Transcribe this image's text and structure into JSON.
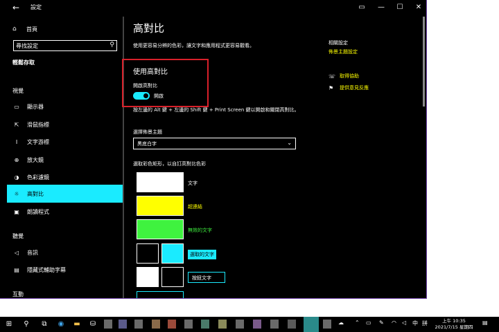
{
  "window": {
    "title": "設定",
    "back_icon": "back-arrow-icon",
    "controls": [
      "minimize-icon",
      "maximize-icon",
      "close-icon"
    ],
    "border_color": "#6b3fa8"
  },
  "sidebar": {
    "home_label": "首頁",
    "search_value": "尋找設定",
    "category": "輕鬆存取",
    "groups": [
      "視覺",
      "聽覺",
      "互動"
    ],
    "items": [
      {
        "label": "顯示器",
        "icon": "monitor-icon"
      },
      {
        "label": "滑鼠指標",
        "icon": "mouse-pointer-icon"
      },
      {
        "label": "文字游標",
        "icon": "text-cursor-icon"
      },
      {
        "label": "放大鏡",
        "icon": "magnifier-icon"
      },
      {
        "label": "色彩濾鏡",
        "icon": "color-filter-icon"
      },
      {
        "label": "高對比",
        "icon": "high-contrast-icon",
        "active": true
      },
      {
        "label": "朗讀程式",
        "icon": "narrator-icon"
      },
      {
        "label": "音訊",
        "icon": "speaker-icon"
      },
      {
        "label": "隱藏式輔助字幕",
        "icon": "captions-icon"
      }
    ]
  },
  "main": {
    "title": "高對比",
    "description": "使用更容易分辨的色彩，讓文字和應用程式更容易觀看。",
    "section_title": "使用高對比",
    "toggle_label": "開啟高對比",
    "toggle_state": "開啟",
    "toggle_on": true,
    "hint": "按左邊的 Alt 鍵 + 左邊的 Shift 鍵 + Print Screen 鍵以開啟和關閉高對比。",
    "theme_label": "選擇佈景主題",
    "theme_value": "黑底白字",
    "swatch_label": "選取彩色矩形，以自訂高對比色彩",
    "swatches": {
      "text": {
        "label": "文字",
        "color": "#ffffff"
      },
      "hyperlink": {
        "label": "超連結",
        "color": "#ffff00"
      },
      "disabled": {
        "label": "無效的文字",
        "color": "#3ff23f"
      },
      "selected": {
        "label": "選取的文字",
        "color": "#1aebff"
      },
      "button": {
        "label": "按鈕文字",
        "color": "#ffffff"
      }
    }
  },
  "right": {
    "related_head": "相關設定",
    "related_link": "佈景主題設定",
    "help_link": "取得協助",
    "feedback_link": "提供意見反應"
  },
  "taskbar": {
    "clock_time": "上午 10:35",
    "clock_date": "2021/7/15 星期四",
    "ime_labels": [
      "中",
      "拼"
    ]
  },
  "colors": {
    "accent": "#1aebff",
    "link": "#ffff00",
    "highlight_box": "#d9202a"
  }
}
